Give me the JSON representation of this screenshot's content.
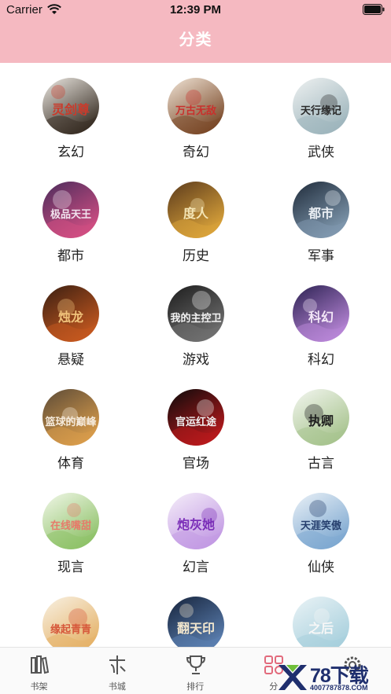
{
  "status_bar": {
    "carrier": "Carrier",
    "time": "12:39 PM"
  },
  "nav": {
    "title": "分类"
  },
  "categories": [
    {
      "label": "玄幻",
      "cover_title": "灵剑尊",
      "colors": [
        "#ece8e2",
        "#3a3026",
        "#c93b2c"
      ]
    },
    {
      "label": "奇幻",
      "cover_title": "万古无敌",
      "colors": [
        "#f0e4d6",
        "#7b4a2a",
        "#c9302c"
      ]
    },
    {
      "label": "武侠",
      "cover_title": "天行缘记",
      "colors": [
        "#eef1f1",
        "#9fb6bd",
        "#2a2a2a"
      ]
    },
    {
      "label": "都市",
      "cover_title": "极品天王",
      "colors": [
        "#4b2c5c",
        "#cf4e82",
        "#f1e3ee"
      ]
    },
    {
      "label": "历史",
      "cover_title": "度人",
      "colors": [
        "#5b3a1c",
        "#d9a23a",
        "#f4e5b5"
      ]
    },
    {
      "label": "军事",
      "cover_title": "都市",
      "colors": [
        "#1f2b3a",
        "#7f98ae",
        "#e9eef3"
      ]
    },
    {
      "label": "悬疑",
      "cover_title": "烛龙",
      "colors": [
        "#3a1f12",
        "#c2571f",
        "#f0c27a"
      ]
    },
    {
      "label": "游戏",
      "cover_title": "我的主控卫",
      "colors": [
        "#1c1c1c",
        "#6f6f6f",
        "#f2f2f2"
      ]
    },
    {
      "label": "科幻",
      "cover_title": "科幻",
      "colors": [
        "#2c2252",
        "#b785d6",
        "#f4e8f8"
      ]
    },
    {
      "label": "体育",
      "cover_title": "篮球的巅峰",
      "colors": [
        "#5c4b38",
        "#d79b4a",
        "#f5eadb"
      ]
    },
    {
      "label": "官场",
      "cover_title": "官运红途",
      "colors": [
        "#0b0b0b",
        "#b6191c",
        "#f1f1f1"
      ]
    },
    {
      "label": "古言",
      "cover_title": "执卿",
      "colors": [
        "#f3f6f0",
        "#a8c48f",
        "#1e1e1e"
      ]
    },
    {
      "label": "现言",
      "cover_title": "在线嘴甜",
      "colors": [
        "#f1f7e8",
        "#8fc26a",
        "#e67a6a"
      ]
    },
    {
      "label": "幻言",
      "cover_title": "炮灰她",
      "colors": [
        "#f5eef9",
        "#c39be4",
        "#7b2fb8"
      ]
    },
    {
      "label": "仙侠",
      "cover_title": "天涯笑傲",
      "colors": [
        "#eaf1f7",
        "#7fa9d1",
        "#263f6e"
      ]
    },
    {
      "label": "",
      "cover_title": "缘起青青",
      "colors": [
        "#f8f1e3",
        "#e5b36a",
        "#d6573a"
      ]
    },
    {
      "label": "",
      "cover_title": "翻天印",
      "colors": [
        "#16233b",
        "#5b7fb0",
        "#f1e6ce"
      ]
    },
    {
      "label": "",
      "cover_title": "之后",
      "colors": [
        "#eaf3f6",
        "#a8d0dd",
        "#f7f7f7"
      ]
    }
  ],
  "tabbar": {
    "items": [
      {
        "label": "书架",
        "icon": "bookshelf-icon"
      },
      {
        "label": "书城",
        "icon": "bookstore-icon"
      },
      {
        "label": "排行",
        "icon": "trophy-icon"
      },
      {
        "label": "分",
        "icon": "category-icon"
      },
      {
        "label": "",
        "icon": "settings-icon"
      }
    ],
    "active_color": "#e26a7c",
    "inactive_color": "#555555"
  },
  "watermark": {
    "title": "78下载",
    "url": "4007787878.COM"
  },
  "colors": {
    "header": "#f5b9c1",
    "title_text": "#ffffff"
  }
}
